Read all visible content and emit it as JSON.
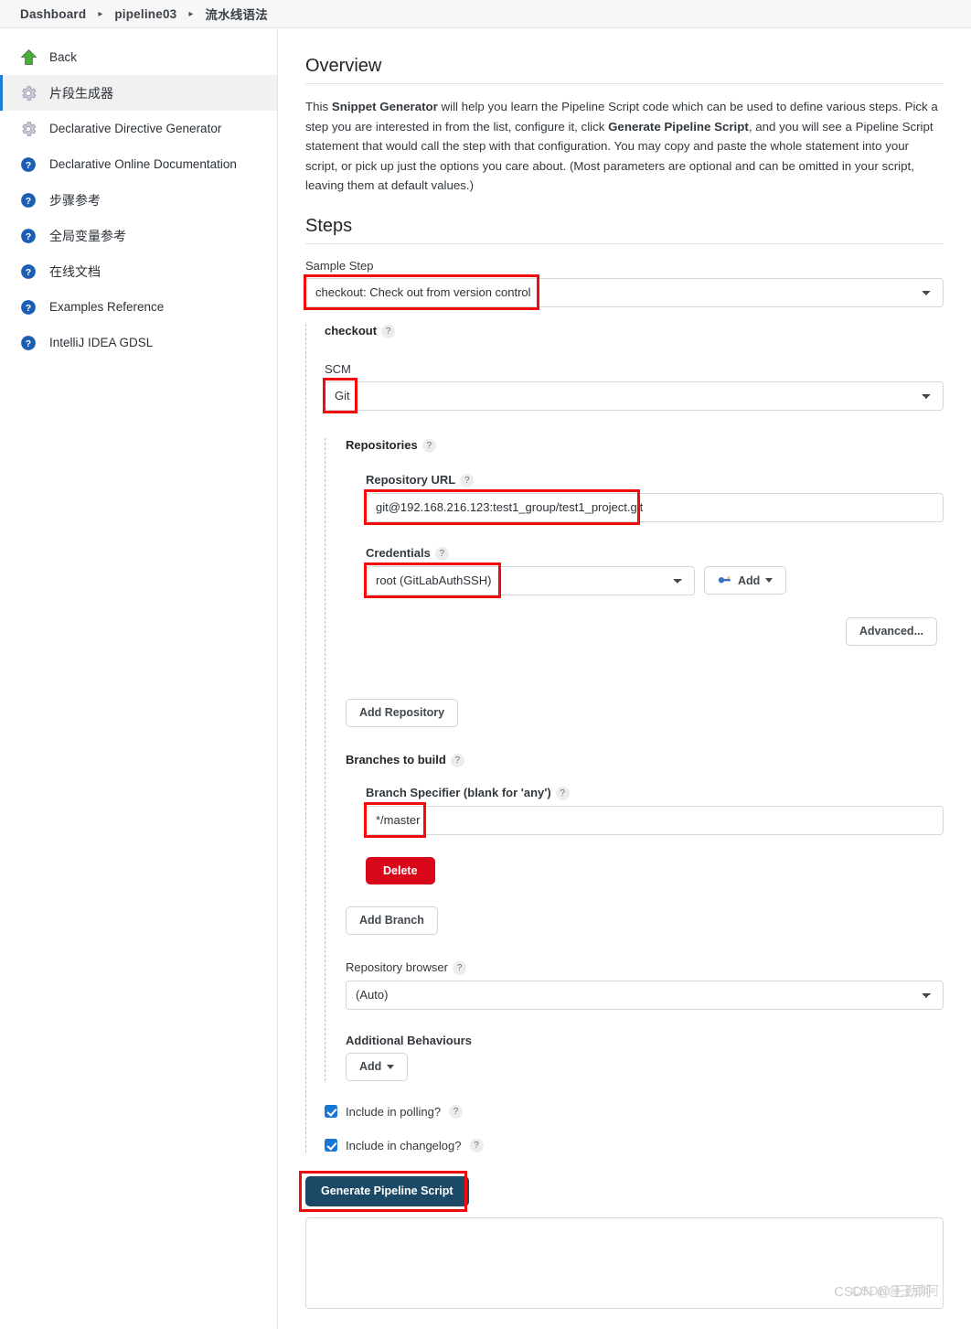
{
  "breadcrumb": {
    "items": [
      "Dashboard",
      "pipeline03",
      "流水线语法"
    ],
    "separator": "▸"
  },
  "sidebar": {
    "items": [
      {
        "label": "Back",
        "icon": "up-arrow-icon",
        "active": false
      },
      {
        "label": "片段生成器",
        "icon": "gear-icon",
        "active": true
      },
      {
        "label": "Declarative Directive Generator",
        "icon": "gear-icon",
        "active": false
      },
      {
        "label": "Declarative Online Documentation",
        "icon": "help-icon",
        "active": false
      },
      {
        "label": "步骤参考",
        "icon": "help-icon",
        "active": false
      },
      {
        "label": "全局变量参考",
        "icon": "help-icon",
        "active": false
      },
      {
        "label": "在线文档",
        "icon": "help-icon",
        "active": false
      },
      {
        "label": "Examples Reference",
        "icon": "help-icon",
        "active": false
      },
      {
        "label": "IntelliJ IDEA GDSL",
        "icon": "help-icon",
        "active": false
      }
    ]
  },
  "overview": {
    "heading": "Overview",
    "para_1": "This ",
    "bold_1": "Snippet Generator",
    "para_2": " will help you learn the Pipeline Script code which can be used to define various steps. Pick a step you are interested in from the list, configure it, click ",
    "bold_2": "Generate Pipeline Script",
    "para_3": ", and you will see a Pipeline Script statement that would call the step with that configuration. You may copy and paste the whole statement into your script, or pick up just the options you care about. (Most parameters are optional and can be omitted in your script, leaving them at default values.)"
  },
  "steps": {
    "heading": "Steps",
    "sample_step_label": "Sample Step",
    "sample_step_value": "checkout: Check out from version control",
    "checkout": {
      "title": "checkout",
      "help": "?",
      "scm_label": "SCM",
      "scm_value": "Git",
      "repositories": {
        "label": "Repositories",
        "help": "?",
        "url_label": "Repository URL",
        "url_help": "?",
        "url_value": "git@192.168.216.123:test1_group/test1_project.git",
        "credentials_label": "Credentials",
        "credentials_help": "?",
        "credentials_value": "root (GitLabAuthSSH)",
        "add_credentials_label": "Add",
        "advanced_label": "Advanced...",
        "add_repository_label": "Add Repository"
      },
      "branches": {
        "label": "Branches to build",
        "help": "?",
        "specifier_label": "Branch Specifier (blank for 'any')",
        "specifier_help": "?",
        "specifier_value": "*/master",
        "delete_label": "Delete",
        "add_branch_label": "Add Branch"
      },
      "repository_browser": {
        "label": "Repository browser",
        "help": "?",
        "value": "(Auto)"
      },
      "additional_behaviours": {
        "label": "Additional Behaviours",
        "add_label": "Add"
      },
      "include_polling": {
        "label": "Include in polling?",
        "help": "?",
        "checked": true
      },
      "include_changelog": {
        "label": "Include in changelog?",
        "help": "?",
        "checked": true
      }
    },
    "generate_button_label": "Generate Pipeline Script",
    "output_value": ""
  },
  "watermark": {
    "text_a": "CSDN @王劲阿",
    "text_b": "CSDN@王劲阿"
  },
  "colors": {
    "highlight": "#f10c0c",
    "accent": "#1c7cd6",
    "primary_button": "#1c4966",
    "danger": "#d9071a",
    "checkbox": "#1877d2"
  }
}
